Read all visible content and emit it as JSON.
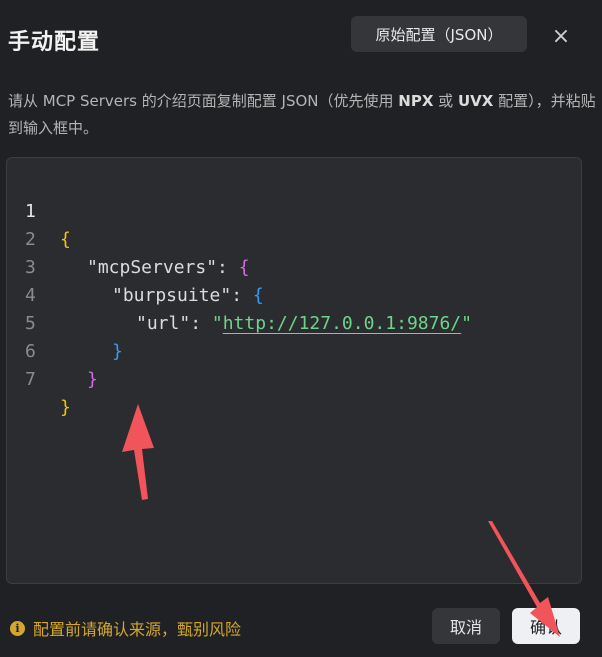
{
  "dialog": {
    "title": "手动配置",
    "raw_config_label": "原始配置（JSON）",
    "close_glyph": "×",
    "description_parts": {
      "p1": "请从 MCP Servers 的介绍页面复制配置 JSON（优先使用 ",
      "npx": "NPX",
      "p2": " 或 ",
      "uvx": "UVX",
      "p3": " 配置），并粘贴到输入框中。"
    }
  },
  "editor": {
    "line_numbers": [
      "1",
      "2",
      "3",
      "4",
      "5",
      "6",
      "7"
    ],
    "lines": {
      "l1": "{",
      "l2_key": "\"mcpServers\"",
      "l2_colon": ": ",
      "l2_brace": "{",
      "l3_key": "\"burpsuite\"",
      "l3_colon": ": ",
      "l3_brace": "{",
      "l4_key": "\"url\"",
      "l4_colon": ": ",
      "l4_q1": "\"",
      "l4_url": "http://127.0.0.1:9876/",
      "l4_q2": "\"",
      "l5": "}",
      "l6": "}",
      "l7": "}"
    }
  },
  "footer": {
    "info_glyph": "i",
    "note": "配置前请确认来源，甄别风险",
    "cancel_label": "取消",
    "confirm_label": "确认"
  },
  "colors": {
    "accent_warning": "#d4a72c",
    "url_green": "#6fd38a",
    "annotation_arrow": "#f2545b"
  },
  "icons": {
    "close": "close-icon",
    "info": "info-icon"
  }
}
